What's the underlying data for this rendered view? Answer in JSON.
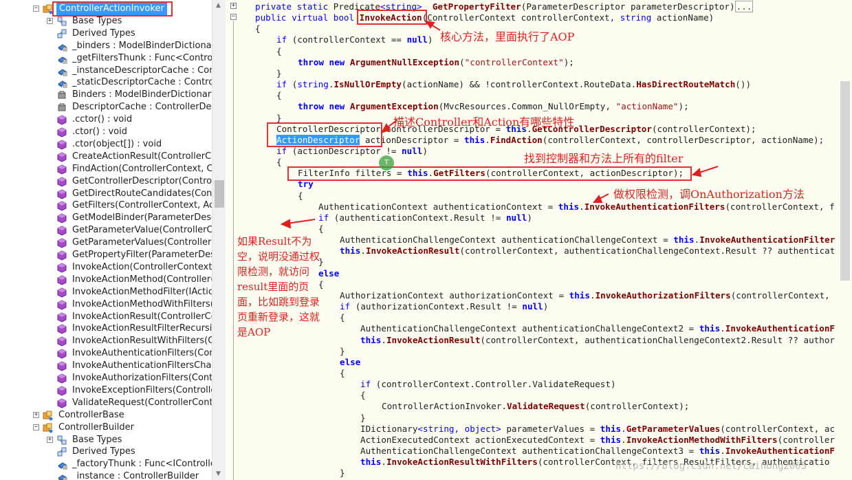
{
  "tree": {
    "items": [
      {
        "label": "ControllerActionInvoker",
        "icon": "class-icon",
        "expander": "⊟"
      },
      {
        "label": "Base Types",
        "icon": "base-types-icon",
        "expander": "⊞"
      },
      {
        "label": "Derived Types",
        "icon": "derived-types-icon",
        "expander": ""
      },
      {
        "label": "_binders : ModelBinderDictionar",
        "icon": "field-icon",
        "expander": ""
      },
      {
        "label": "_getFiltersThunk : Func<Controll",
        "icon": "field-icon",
        "expander": ""
      },
      {
        "label": "_instanceDescriptorCache : Contr",
        "icon": "field-icon",
        "expander": ""
      },
      {
        "label": "_staticDescriptorCache : Controll",
        "icon": "field-icon",
        "expander": ""
      },
      {
        "label": "Binders : ModelBinderDictionary",
        "icon": "property-icon",
        "expander": ""
      },
      {
        "label": "DescriptorCache : ControllerDesc",
        "icon": "property-icon",
        "expander": ""
      },
      {
        "label": ".cctor() : void",
        "icon": "method-icon",
        "expander": ""
      },
      {
        "label": ".ctor() : void",
        "icon": "method-icon",
        "expander": ""
      },
      {
        "label": ".ctor(object[]) : void",
        "icon": "method-icon",
        "expander": ""
      },
      {
        "label": "CreateActionResult(ControllerCc",
        "icon": "method-icon",
        "expander": ""
      },
      {
        "label": "FindAction(ControllerContext, Cc",
        "icon": "method-icon",
        "expander": ""
      },
      {
        "label": "GetControllerDescriptor(Control",
        "icon": "method-icon",
        "expander": ""
      },
      {
        "label": "GetDirectRouteCandidates(Contr",
        "icon": "method-icon",
        "expander": ""
      },
      {
        "label": "GetFilters(ControllerContext, Act",
        "icon": "method-icon",
        "expander": ""
      },
      {
        "label": "GetModelBinder(ParameterDesc",
        "icon": "method-icon",
        "expander": ""
      },
      {
        "label": "GetParameterValue(ControllerCc",
        "icon": "method-icon",
        "expander": ""
      },
      {
        "label": "GetParameterValues(ControllerC",
        "icon": "method-icon",
        "expander": ""
      },
      {
        "label": "GetPropertyFilter(ParameterDes",
        "icon": "method-icon",
        "expander": ""
      },
      {
        "label": "InvokeAction(ControllerContext,",
        "icon": "method-icon",
        "expander": ""
      },
      {
        "label": "InvokeActionMethod(Controller(",
        "icon": "method-icon",
        "expander": ""
      },
      {
        "label": "InvokeActionMethodFilter(IActic",
        "icon": "method-icon",
        "expander": ""
      },
      {
        "label": "InvokeActionMethodWithFilters(",
        "icon": "method-icon",
        "expander": ""
      },
      {
        "label": "InvokeActionResult(ControllerCc",
        "icon": "method-icon",
        "expander": ""
      },
      {
        "label": "InvokeActionResultFilterRecursiv",
        "icon": "method-icon",
        "expander": ""
      },
      {
        "label": "InvokeActionResultWithFilters(Cc",
        "icon": "method-icon",
        "expander": ""
      },
      {
        "label": "InvokeAuthenticationFilters(Cont",
        "icon": "method-icon",
        "expander": ""
      },
      {
        "label": "InvokeAuthenticationFiltersChalle",
        "icon": "method-icon",
        "expander": ""
      },
      {
        "label": "InvokeAuthorizationFilters(Contr",
        "icon": "method-icon",
        "expander": ""
      },
      {
        "label": "InvokeExceptionFilters(Controlle",
        "icon": "method-icon",
        "expander": ""
      },
      {
        "label": "ValidateRequest(ControllerConte",
        "icon": "method-icon",
        "expander": ""
      },
      {
        "label": "ControllerBase",
        "icon": "class-icon",
        "expander": "⊞"
      },
      {
        "label": "ControllerBuilder",
        "icon": "class-icon",
        "expander": "⊟"
      },
      {
        "label": "Base Types",
        "icon": "base-types-icon",
        "expander": "⊞"
      },
      {
        "label": "Derived Types",
        "icon": "derived-types-icon",
        "expander": ""
      },
      {
        "label": "_factoryThunk : Func<IController",
        "icon": "field-icon",
        "expander": ""
      },
      {
        "label": "_instance : ControllerBuilder",
        "icon": "field-icon",
        "expander": ""
      }
    ]
  },
  "code": {
    "lines": [
      {
        "indent": 1,
        "parts": [
          [
            "kw",
            "private static "
          ],
          [
            "tp",
            "Predicate"
          ],
          [
            "kw",
            "<string>"
          ],
          [
            "",
            "  "
          ],
          [
            "mt",
            "GetPropertyFilter"
          ],
          [
            "",
            "(ParameterDescriptor parameterDescriptor)"
          ],
          [
            "ellip",
            "..."
          ]
        ]
      },
      {
        "indent": 1,
        "parts": [
          [
            "kw",
            "public virtual bool "
          ],
          [
            "mt",
            "InvokeAction"
          ],
          [
            "",
            "(ControllerContext controllerContext, "
          ],
          [
            "kw",
            "string"
          ],
          [
            "",
            " actionName)"
          ]
        ]
      },
      {
        "indent": 1,
        "parts": [
          [
            "",
            "{"
          ]
        ]
      },
      {
        "indent": 2,
        "parts": [
          [
            "kw",
            "if"
          ],
          [
            "",
            " (controllerContext == "
          ],
          [
            "kwb",
            "null"
          ],
          [
            "",
            ")"
          ]
        ]
      },
      {
        "indent": 2,
        "parts": [
          [
            "",
            "{"
          ]
        ]
      },
      {
        "indent": 3,
        "parts": [
          [
            "kwb",
            "throw new "
          ],
          [
            "mt",
            "ArgumentNullException"
          ],
          [
            "",
            "("
          ],
          [
            "str",
            "\"controllerContext\""
          ],
          [
            "",
            ");"
          ]
        ]
      },
      {
        "indent": 2,
        "parts": [
          [
            "",
            "}"
          ]
        ]
      },
      {
        "indent": 2,
        "parts": [
          [
            "kw",
            "if"
          ],
          [
            "",
            " ("
          ],
          [
            "kw",
            "string"
          ],
          [
            "",
            "."
          ],
          [
            "mt",
            "IsNullOrEmpty"
          ],
          [
            "",
            "(actionName) && !controllerContext.RouteData."
          ],
          [
            "mt",
            "HasDirectRouteMatch"
          ],
          [
            "",
            "())"
          ]
        ]
      },
      {
        "indent": 2,
        "parts": [
          [
            "",
            "{"
          ]
        ]
      },
      {
        "indent": 3,
        "parts": [
          [
            "kwb",
            "throw new "
          ],
          [
            "mt",
            "ArgumentException"
          ],
          [
            "",
            "(MvcResources.Common_NullOrEmpty, "
          ],
          [
            "str",
            "\"actionName\""
          ],
          [
            "",
            ");"
          ]
        ]
      },
      {
        "indent": 2,
        "parts": [
          [
            "",
            "}"
          ]
        ]
      },
      {
        "indent": 2,
        "parts": [
          [
            "",
            "ControllerDescriptor controllerDescriptor = "
          ],
          [
            "kwb",
            "this"
          ],
          [
            "",
            "."
          ],
          [
            "mt",
            "GetControllerDescriptor"
          ],
          [
            "",
            "(controllerContext);"
          ]
        ]
      },
      {
        "indent": 2,
        "parts": [
          [
            "hl",
            "ActionDescriptor"
          ],
          [
            "",
            " actionDescriptor = "
          ],
          [
            "kwb",
            "this"
          ],
          [
            "",
            "."
          ],
          [
            "mt",
            "FindAction"
          ],
          [
            "",
            "(controllerContext, controllerDescriptor, actionName);"
          ]
        ]
      },
      {
        "indent": 2,
        "parts": [
          [
            "kw",
            "if"
          ],
          [
            "",
            " (actionDescriptor != "
          ],
          [
            "kwb",
            "null"
          ],
          [
            "",
            ")"
          ]
        ]
      },
      {
        "indent": 2,
        "parts": [
          [
            "",
            "{"
          ]
        ]
      },
      {
        "indent": 3,
        "parts": [
          [
            "",
            "FilterInfo filters = "
          ],
          [
            "kwb",
            "this"
          ],
          [
            "",
            "."
          ],
          [
            "mt",
            "GetFilters"
          ],
          [
            "",
            "(controllerContext, actionDescriptor);"
          ]
        ]
      },
      {
        "indent": 3,
        "parts": [
          [
            "kwb",
            "try"
          ]
        ]
      },
      {
        "indent": 3,
        "parts": [
          [
            "",
            "{"
          ]
        ]
      },
      {
        "indent": 4,
        "parts": [
          [
            "",
            "AuthenticationContext authenticationContext = "
          ],
          [
            "kwb",
            "this"
          ],
          [
            "",
            "."
          ],
          [
            "mt",
            "InvokeAuthenticationFilters"
          ],
          [
            "",
            "(controllerContext, f"
          ]
        ]
      },
      {
        "indent": 4,
        "parts": [
          [
            "kw",
            "if"
          ],
          [
            "",
            " (authenticationContext.Result != "
          ],
          [
            "kwb",
            "null"
          ],
          [
            "",
            ")"
          ]
        ]
      },
      {
        "indent": 4,
        "parts": [
          [
            "",
            "{"
          ]
        ]
      },
      {
        "indent": 5,
        "parts": [
          [
            "",
            "AuthenticationChallengeContext authenticationChallengeContext = "
          ],
          [
            "kwb",
            "this"
          ],
          [
            "",
            "."
          ],
          [
            "mt",
            "InvokeAuthenticationFilter"
          ]
        ]
      },
      {
        "indent": 5,
        "parts": [
          [
            "kwb",
            "this"
          ],
          [
            "",
            "."
          ],
          [
            "mt",
            "InvokeActionResult"
          ],
          [
            "",
            "(controllerContext, authenticationChallengeContext.Result ?? authenticat"
          ]
        ]
      },
      {
        "indent": 4,
        "parts": [
          [
            "",
            "}"
          ]
        ]
      },
      {
        "indent": 4,
        "parts": [
          [
            "kwb",
            "else"
          ]
        ]
      },
      {
        "indent": 4,
        "parts": [
          [
            "",
            "{"
          ]
        ]
      },
      {
        "indent": 5,
        "parts": [
          [
            "",
            "AuthorizationContext authorizationContext = "
          ],
          [
            "kwb",
            "this"
          ],
          [
            "",
            "."
          ],
          [
            "mt",
            "InvokeAuthorizationFilters"
          ],
          [
            "",
            "(controllerContext, "
          ]
        ]
      },
      {
        "indent": 5,
        "parts": [
          [
            "kw",
            "if"
          ],
          [
            "",
            " (authorizationContext.Result != "
          ],
          [
            "kwb",
            "null"
          ],
          [
            "",
            ")"
          ]
        ]
      },
      {
        "indent": 5,
        "parts": [
          [
            "",
            "{"
          ]
        ]
      },
      {
        "indent": 6,
        "parts": [
          [
            "",
            "AuthenticationChallengeContext authenticationChallengeContext2 = "
          ],
          [
            "kwb",
            "this"
          ],
          [
            "",
            "."
          ],
          [
            "mt",
            "InvokeAuthenticationF"
          ]
        ]
      },
      {
        "indent": 6,
        "parts": [
          [
            "kwb",
            "this"
          ],
          [
            "",
            "."
          ],
          [
            "mt",
            "InvokeActionResult"
          ],
          [
            "",
            "(controllerContext, authenticationChallengeContext2.Result ?? author"
          ]
        ]
      },
      {
        "indent": 5,
        "parts": [
          [
            "",
            "}"
          ]
        ]
      },
      {
        "indent": 5,
        "parts": [
          [
            "kwb",
            "else"
          ]
        ]
      },
      {
        "indent": 5,
        "parts": [
          [
            "",
            "{"
          ]
        ]
      },
      {
        "indent": 6,
        "parts": [
          [
            "kw",
            "if"
          ],
          [
            "",
            " (controllerContext.Controller.ValidateRequest)"
          ]
        ]
      },
      {
        "indent": 6,
        "parts": [
          [
            "",
            "{"
          ]
        ]
      },
      {
        "indent": 7,
        "parts": [
          [
            "",
            "ControllerActionInvoker."
          ],
          [
            "mt",
            "ValidateRequest"
          ],
          [
            "",
            "(controllerContext);"
          ]
        ]
      },
      {
        "indent": 6,
        "parts": [
          [
            "",
            "}"
          ]
        ]
      },
      {
        "indent": 6,
        "parts": [
          [
            "",
            "IDictionary"
          ],
          [
            "kw",
            "<string, object>"
          ],
          [
            "",
            " parameterValues = "
          ],
          [
            "kwb",
            "this"
          ],
          [
            "",
            "."
          ],
          [
            "mt",
            "GetParameterValues"
          ],
          [
            "",
            "(controllerContext, ac"
          ]
        ]
      },
      {
        "indent": 6,
        "parts": [
          [
            "",
            "ActionExecutedContext actionExecutedContext = "
          ],
          [
            "kwb",
            "this"
          ],
          [
            "",
            "."
          ],
          [
            "mt",
            "InvokeActionMethodWithFilters"
          ],
          [
            "",
            "(controller"
          ]
        ]
      },
      {
        "indent": 6,
        "parts": [
          [
            "",
            "AuthenticationChallengeContext authenticationChallengeContext3 = "
          ],
          [
            "kwb",
            "this"
          ],
          [
            "",
            "."
          ],
          [
            "mt",
            "InvokeAuthenticationF"
          ]
        ]
      },
      {
        "indent": 6,
        "parts": [
          [
            "kwb",
            "this"
          ],
          [
            "",
            "."
          ],
          [
            "mt",
            "InvokeActionResultWithFilters"
          ],
          [
            "",
            "(controllerContext, filters.ResultFilters, authenticatio"
          ]
        ]
      },
      {
        "indent": 5,
        "parts": [
          [
            "",
            "}"
          ]
        ]
      }
    ]
  },
  "annotations": {
    "core_method": "核心方法，里面执行了AOP",
    "describe": "描述Controller和Action有哪些特性",
    "find_filters": "找到控制器和方法上所有的filter",
    "authorization": "做权限检测，调OnAuthorization方法",
    "result_note": "如果Result不为空，说明没通过权限检测，就访问result里面的页面，比如跳到登录页重新登录，这就是AOP"
  },
  "watermark": "https://blog.csdn.net/cainong2005",
  "colors": {
    "selection": "#3399ff",
    "annotation": "#e02020",
    "keyword": "#0000ff",
    "string": "#a31515",
    "editor_bg": "#fdfdf1"
  }
}
